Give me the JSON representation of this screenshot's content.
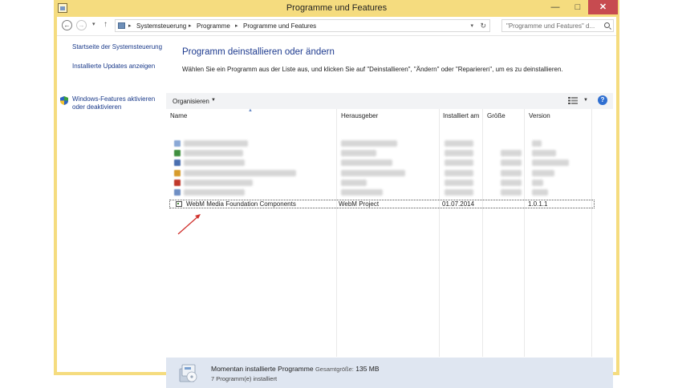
{
  "window": {
    "title": "Programme und Features",
    "min_glyph": "—",
    "max_glyph": "□",
    "close_glyph": "✕"
  },
  "address": {
    "back_glyph": "←",
    "forward_glyph": "→",
    "dropdown_glyph": "▾",
    "up_glyph": "↑",
    "sep_glyph": "▸",
    "breadcrumbs": [
      "Systemsteuerung",
      "Programme",
      "Programme und Features"
    ],
    "refresh_glyph": "↻",
    "search_placeholder": "\"Programme und Features\" d..."
  },
  "sidebar": {
    "links": [
      "Startseite der Systemsteuerung",
      "Installierte Updates anzeigen",
      "Windows-Features aktivieren",
      "oder deaktivieren"
    ]
  },
  "main": {
    "heading": "Programm deinstallieren oder ändern",
    "description": "Wählen Sie ein Programm aus der Liste aus, und klicken Sie auf \"Deinstallieren\", \"Ändern\" oder \"Reparieren\", um es zu deinstallieren."
  },
  "toolbar": {
    "organize_label": "Organisieren",
    "caret": "▼",
    "help_glyph": "?"
  },
  "columns": {
    "sort_glyph": "▲",
    "name": "Name",
    "publisher": "Herausgeber",
    "installed": "Installiert am",
    "size": "Größe",
    "version": "Version"
  },
  "blurred_icon_colors": [
    "#8aa8d6",
    "#3f8f3f",
    "#4a6fb0",
    "#d79b2b",
    "#c0392b",
    "#6f8fc4"
  ],
  "selected_program": {
    "name": "WebM Media Foundation Components",
    "publisher": "WebM Project",
    "installed": "01.07.2014",
    "size": "",
    "version": "1.0.1.1"
  },
  "annotation_color": "#d0312d",
  "status": {
    "title": "Momentan installierte Programme",
    "total_size_label": "Gesamtgröße:",
    "total_size": "135 MB",
    "count_text": "7 Programm(e) installiert"
  }
}
